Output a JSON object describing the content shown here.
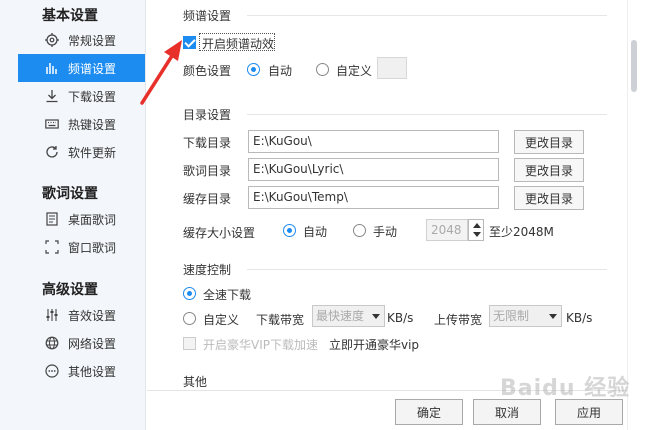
{
  "sidebar": {
    "groups": [
      {
        "title": "基本设置",
        "items": [
          {
            "label": "常规设置",
            "icon": "gear-icon",
            "active": false
          },
          {
            "label": "频谱设置",
            "icon": "spectrum-bars-icon",
            "active": true
          },
          {
            "label": "下载设置",
            "icon": "download-icon",
            "active": false
          },
          {
            "label": "热键设置",
            "icon": "keyboard-icon",
            "active": false
          },
          {
            "label": "软件更新",
            "icon": "refresh-icon",
            "active": false
          }
        ]
      },
      {
        "title": "歌词设置",
        "items": [
          {
            "label": "桌面歌词",
            "icon": "desktop-lyrics-icon",
            "active": false
          },
          {
            "label": "窗口歌词",
            "icon": "window-lyrics-icon",
            "active": false
          }
        ]
      },
      {
        "title": "高级设置",
        "items": [
          {
            "label": "音效设置",
            "icon": "equalizer-icon",
            "active": false
          },
          {
            "label": "网络设置",
            "icon": "globe-icon",
            "active": false
          },
          {
            "label": "其他设置",
            "icon": "more-icon",
            "active": false
          }
        ]
      }
    ]
  },
  "spectrum": {
    "section_title": "频谱设置",
    "enable_label": "开启频谱动效",
    "enable_checked": true,
    "color_label": "颜色设置",
    "auto_label": "自动",
    "custom_label": "自定义"
  },
  "directory": {
    "section_title": "目录设置",
    "rows": [
      {
        "label": "下载目录",
        "value": "E:\\KuGou\\",
        "button": "更改目录"
      },
      {
        "label": "歌词目录",
        "value": "E:\\KuGou\\Lyric\\",
        "button": "更改目录"
      },
      {
        "label": "缓存目录",
        "value": "E:\\KuGou\\Temp\\",
        "button": "更改目录"
      }
    ],
    "cache_size_label": "缓存大小设置",
    "cache_auto_label": "自动",
    "cache_manual_label": "手动",
    "cache_value": "2048",
    "cache_min_label": "至少2048M"
  },
  "speed": {
    "section_title": "速度控制",
    "full_speed_label": "全速下载",
    "custom_label": "自定义",
    "download_bw_label": "下载带宽",
    "download_bw_value": "最快速度",
    "unit1": "KB/s",
    "upload_bw_label": "上传带宽",
    "upload_bw_value": "无限制",
    "unit2": "KB/s",
    "vip_label": "开启豪华VIP下载加速",
    "vip_link": "立即开通豪华vip"
  },
  "other": {
    "section_title": "其他"
  },
  "footer": {
    "ok": "确定",
    "cancel": "取消",
    "apply": "应用"
  },
  "watermark": "Baidu 经验",
  "colors": {
    "accent": "#1d8cf0",
    "annotation_arrow": "#e8302a"
  }
}
